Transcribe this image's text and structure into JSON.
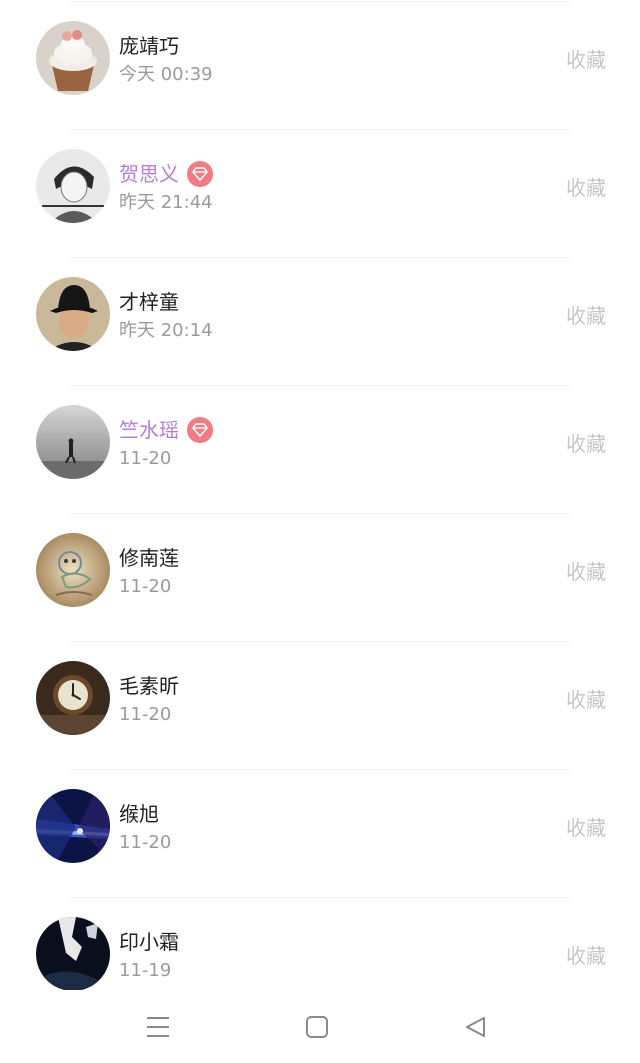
{
  "list": {
    "favorite_label": "收藏",
    "rows": [
      {
        "name": "庞靖巧",
        "time": "今天 00:39",
        "vip": false,
        "avatar": "cupcake"
      },
      {
        "name": "贺思义",
        "time": "昨天 21:44",
        "vip": true,
        "avatar": "sketch-portrait"
      },
      {
        "name": "才梓童",
        "time": "昨天 20:14",
        "vip": false,
        "avatar": "bucket-hat-portrait"
      },
      {
        "name": "竺水瑶",
        "time": "11-20",
        "vip": true,
        "avatar": "foggy-figure"
      },
      {
        "name": "修南莲",
        "time": "11-20",
        "vip": false,
        "avatar": "cartoon-doodle"
      },
      {
        "name": "毛素昕",
        "time": "11-20",
        "vip": false,
        "avatar": "clock"
      },
      {
        "name": "缑旭",
        "time": "11-20",
        "vip": false,
        "avatar": "light-tunnel"
      },
      {
        "name": "印小霜",
        "time": "11-19",
        "vip": false,
        "avatar": "dark-figure"
      }
    ]
  },
  "colors": {
    "name": "#222222",
    "vip_name": "#b87dd8",
    "badge": "#f27a82",
    "time": "#9b9b9b",
    "favorite": "#c6c6c6"
  },
  "navbar": {
    "icons": [
      "menu-icon",
      "home-square-icon",
      "back-triangle-icon"
    ]
  }
}
